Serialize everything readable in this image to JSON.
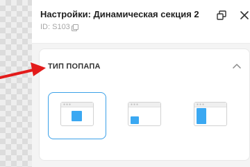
{
  "header": {
    "title": "Настройки: Динамическая секция 2",
    "id_label": "ID: S103"
  },
  "section": {
    "title": "ТИП ПОПАПА"
  },
  "popup_types": [
    {
      "name": "center",
      "selected": true
    },
    {
      "name": "bottom-left",
      "selected": false
    },
    {
      "name": "side",
      "selected": false
    }
  ],
  "colors": {
    "accent": "#3aa8f2",
    "selected_border": "#3aa0e8",
    "arrow": "#e31b1b"
  },
  "icons": {
    "windows": "windows-icon",
    "close": "close-icon",
    "copy": "copy-icon",
    "collapse": "chevron-up-icon"
  }
}
